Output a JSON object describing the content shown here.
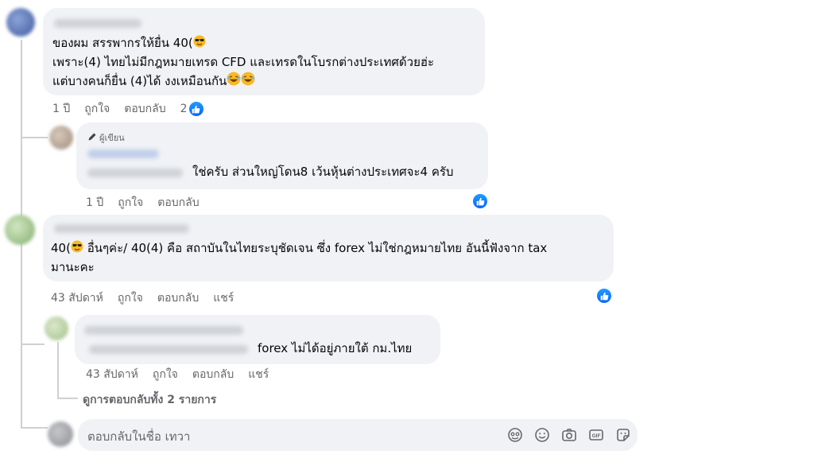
{
  "comments": [
    {
      "lines": [
        "ของผม สรรพากรให้ยื่น 40(",
        "เพราะ(4) ไทยไม่มีกฎหมายเทรด CFD และเทรดในโบรกต่างประเทศด้วยฮ่ะ",
        "แต่บางคนก็ยื่น (4)ได้ งงเหมือนกัน"
      ],
      "time": "1 ปี",
      "like_label": "ถูกใจ",
      "reply_label": "ตอบกลับ",
      "reactions": "2"
    },
    {
      "author_badge": "ผู้เขียน",
      "text": "ใช่ครับ ส่วนใหญ่โดน8 เว้นหุ้นต่างประเทศจะ4 ครับ",
      "time": "1 ปี",
      "like_label": "ถูกใจ",
      "reply_label": "ตอบกลับ"
    },
    {
      "lines": [
        "40(",
        " อื่นๆค่ะ/ 40(4) คือ สถาบันในไทยระบุชัดเจน ซึ่ง forex ไม่ใช่กฎหมายไทย อันนี้ฟังจาก tax",
        "มานะคะ"
      ],
      "time": "43 สัปดาห์",
      "like_label": "ถูกใจ",
      "reply_label": "ตอบกลับ",
      "share_label": "แชร์"
    },
    {
      "text": "forex ไม่ได้อยู่ภายใต้ กม.ไทย",
      "time": "43 สัปดาห์",
      "like_label": "ถูกใจ",
      "reply_label": "ตอบกลับ",
      "share_label": "แชร์"
    }
  ],
  "view_replies": "ดูการตอบกลับทั้ง 2 รายการ",
  "composer": {
    "placeholder": "ตอบกลับในชื่อ เทวา",
    "icons": [
      "avatar-sticker-icon",
      "emoji-icon",
      "camera-icon",
      "gif-icon",
      "sticker-icon"
    ]
  },
  "colors": {
    "bubble": "#f0f2f5",
    "meta": "#65676b",
    "like_blue": "#0866ff"
  }
}
